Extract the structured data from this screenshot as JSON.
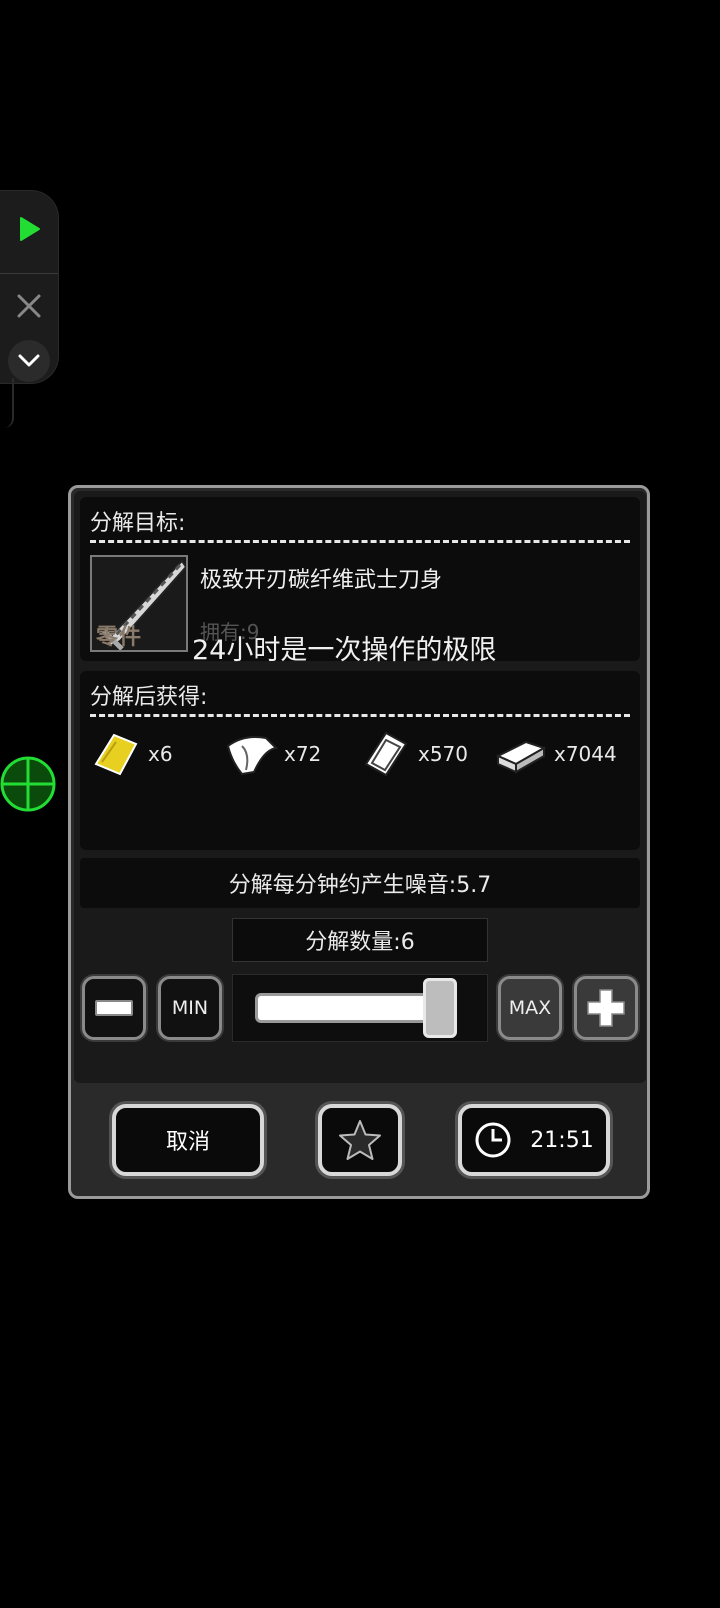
{
  "float_toolbar": {
    "icons": [
      "play-icon",
      "close-icon",
      "chevron-down-icon"
    ],
    "play_color": "#22dd33"
  },
  "crosshair_color": "#22dd33",
  "dialog": {
    "target_section": {
      "title": "分解目标:",
      "item_name": "极致开刃碳纤维武士刀身",
      "item_tag": "零件",
      "owned_label": "拥有:9"
    },
    "rewards_section": {
      "title": "分解后获得:",
      "rewards": [
        {
          "icon": "gold-bar-icon",
          "count": "x6",
          "color": "#e8d020"
        },
        {
          "icon": "silver-sheet-icon",
          "count": "x72",
          "color": "#ffffff"
        },
        {
          "icon": "metal-plate-icon",
          "count": "x570",
          "color": "#ffffff"
        },
        {
          "icon": "iron-ingot-icon",
          "count": "x7044",
          "color": "#ffffff"
        }
      ]
    },
    "noise_text": "分解每分钟约产生噪音:5.7",
    "quantity_text": "分解数量:6",
    "controls": {
      "min_label": "MIN",
      "max_label": "MAX",
      "slider_fraction": 1.0
    },
    "buttons": {
      "cancel_label": "取消",
      "timer_label": "21:51"
    }
  },
  "toast": "24小时是一次操作的极限"
}
